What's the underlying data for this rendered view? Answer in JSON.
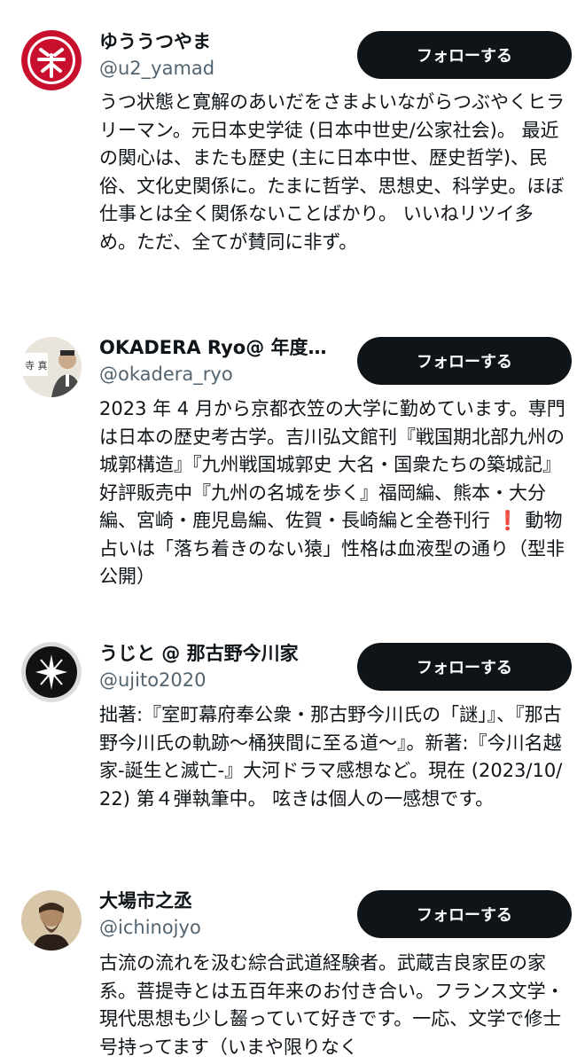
{
  "follow_label": "フォローする",
  "users": [
    {
      "name": "ゆううつやま",
      "handle": "@u2_yamad",
      "bio": "うつ状態と寛解のあいだをさまよいながらつぶやくヒラリーマン。元日本史学徒 (日本中世史/公家社会)。 最近の関心は、またも歴史 (主に日本中世、歴史哲学)、民俗、文化史関係に。たまに哲学、思想史、科学史。ほぼ仕事とは全く関係ないことばかり。 いいねリツイ多め。ただ、全てが賛同に非ず。",
      "avatar": "red-seal-avatar"
    },
    {
      "name": "OKADERA Ryo@ 年度…",
      "handle": "@okadera_ryo",
      "bio_parts": [
        "2023 年 4 月から京都衣笠の大学に勤めています。専門は日本の歴史考古学。吉川弘文館刊『戦国期北部九州の城郭構造』『九州戦国城郭史 大名・国衆たちの築城記』好評販売中『九州の名城を歩く』福岡編、熊本・大分編、宮崎・鹿児島編、佐賀・長崎編と全巻刊行",
        "❗",
        "動物占いは「落ち着きのない猿」性格は血液型の通り（型非公開）"
      ],
      "avatar": "photo-avatar"
    },
    {
      "name": "うじと @ 那古野今川家",
      "handle": "@ujito2020",
      "bio": "拙著:『室町幕府奉公衆・那古野今川氏の「謎」』、『那古野今川氏の軌跡〜桶狭間に至る道〜』。新著:『今川名越家-誕生と滅亡-』大河ドラマ感想など。現在 (2023/10/22) 第４弾執筆中。 呟きは個人の一感想です。",
      "avatar": "emblem-avatar"
    },
    {
      "name": "大場市之丞",
      "handle": "@ichinojyo",
      "bio": "古流の流れを汲む綜合武道経験者。武蔵吉良家臣の家系。菩提寺とは五百年来のお付き合い。フランス文学・現代思想も少し齧っていて好きです。一応、文学で修士号持ってます（いまや限りなく",
      "avatar": "portrait-avatar"
    }
  ]
}
